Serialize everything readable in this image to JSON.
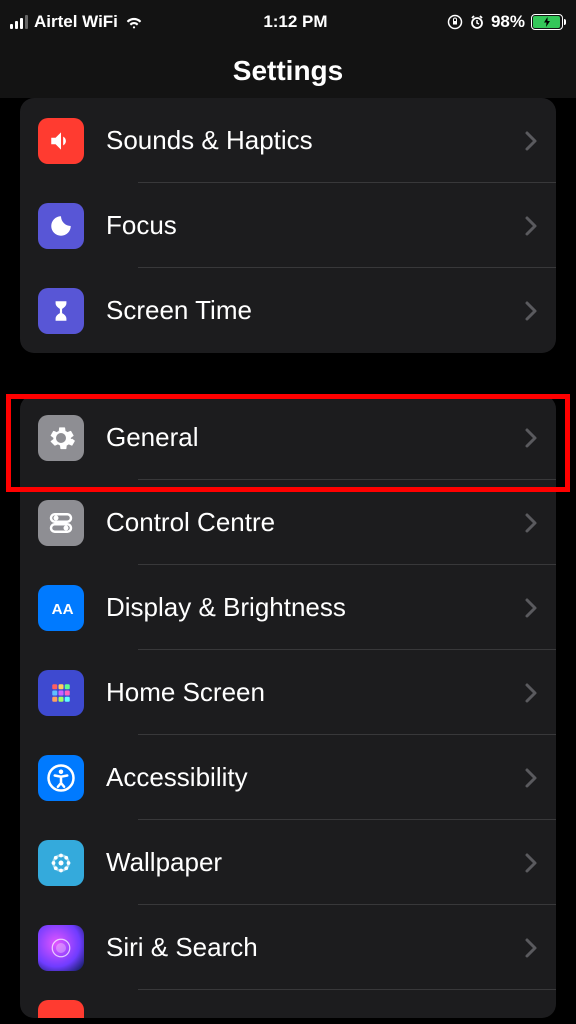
{
  "status_bar": {
    "carrier": "Airtel WiFi",
    "time": "1:12 PM",
    "battery_percent": "98%"
  },
  "header": {
    "title": "Settings"
  },
  "group1": {
    "items": [
      {
        "label": "Sounds & Haptics"
      },
      {
        "label": "Focus"
      },
      {
        "label": "Screen Time"
      }
    ]
  },
  "group2": {
    "items": [
      {
        "label": "General"
      },
      {
        "label": "Control Centre"
      },
      {
        "label": "Display & Brightness"
      },
      {
        "label": "Home Screen"
      },
      {
        "label": "Accessibility"
      },
      {
        "label": "Wallpaper"
      },
      {
        "label": "Siri & Search"
      }
    ]
  }
}
